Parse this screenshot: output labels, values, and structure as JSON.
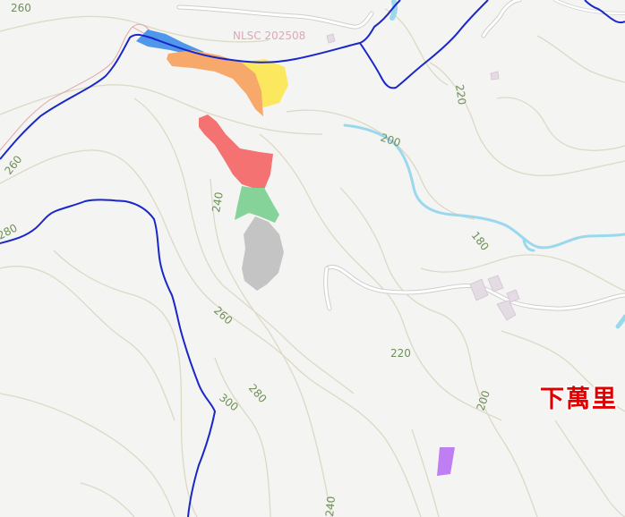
{
  "map": {
    "watermark": "NLSC 202508",
    "place_name": "下萬里",
    "contour_labels": [
      "260",
      "260",
      "280",
      "240",
      "260",
      "280",
      "300",
      "220",
      "220",
      "200",
      "180",
      "200",
      "240"
    ],
    "colors": {
      "background": "#f4f4f2",
      "contour": "#dcd9c4",
      "boundary": "#1a27c8",
      "river": "#9ad8ee",
      "road": "#ffffff",
      "road_outline": "#cfcfcf",
      "place_name": "#e00000",
      "zone_blue": "#4f97ea",
      "zone_orange": "#f6a96b",
      "zone_yellow": "#fbe85f",
      "zone_red": "#f47272",
      "zone_green": "#86d39a",
      "zone_gray": "#c4c4c4",
      "zone_purple": "#bf7ff2"
    }
  }
}
